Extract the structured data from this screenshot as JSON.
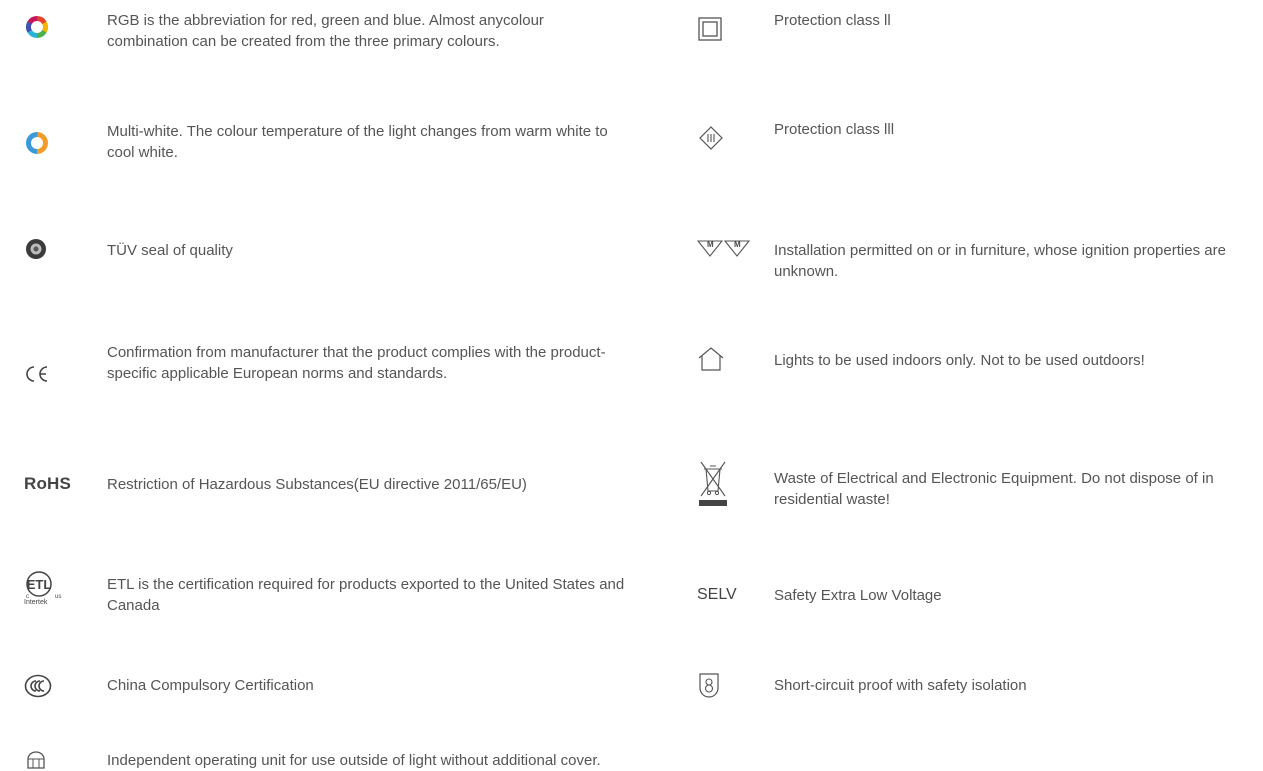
{
  "left": {
    "rgb": "RGB is the abbreviation for red, green and blue. Almost anycolour combination can be created from the three primary colours.",
    "multiwhite": "Multi-white. The colour temperature of the light changes from warm white to cool white.",
    "tuv": "TÜV seal of quality",
    "ce": "Confirmation from manufacturer that the product complies with the product-specific applicable European norms and standards.",
    "rohs_mark": "RoHS",
    "rohs": "Restriction of Hazardous Substances(EU directive 2011/65/EU)",
    "etl": "ETL is the certification required for products exported to the United States and Canada",
    "etl_mark_sub": "Intertek",
    "ccc": "China Compulsory Certification",
    "operating_unit": "Independent operating unit for use outside of light without additional cover."
  },
  "right": {
    "class2": "Protection class ll",
    "class3": "Protection class lll",
    "furniture_mark": "M",
    "furniture": "Installation permitted on or in furniture, whose ignition properties are unknown.",
    "indoor": "Lights to be used indoors only. Not to be used outdoors!",
    "weee": "Waste of Electrical and Electronic Equipment. Do not dispose of in residential waste!",
    "selv_mark": "SELV",
    "selv": "Safety Extra Low Voltage",
    "shortcircuit": "Short-circuit proof with safety isolation"
  }
}
